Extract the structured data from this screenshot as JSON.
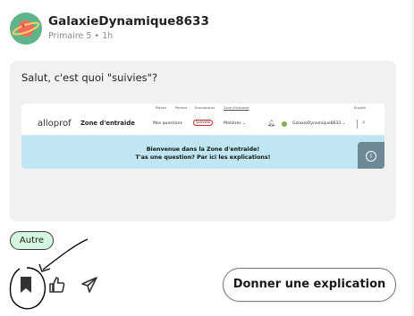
{
  "post": {
    "username": "GalaxieDynamique8633",
    "meta": "Primaire 5 • 1h",
    "avatar_icon": "planet-icon",
    "question": "Salut, c'est quoi \"suivies\"?",
    "tag": "Autre"
  },
  "screenshot": {
    "topnav": [
      "Élèves",
      "Parents",
      "Enseignants",
      "Zone d'entraide",
      "English"
    ],
    "logo": "alloprof",
    "zone_title": "Zone d'entraide",
    "links": [
      "Mes questions",
      "Suivies",
      "Matières ⌄"
    ],
    "user": "GalaxieDynamique8633 ⌄",
    "line1": "Bienvenue dans la Zone d'entraide!",
    "line2": "T'as une question? Par ici les explications!"
  },
  "actions": {
    "bookmark_icon": "bookmark-icon",
    "like_icon": "thumbs-up-icon",
    "share_icon": "share-icon",
    "answer_label": "Donner une explication"
  },
  "colors": {
    "avatar_bg": "#5fb48a",
    "tag_bg": "#d4f5df",
    "card_bg": "#f1f1f1",
    "screenshot_bg": "#bfe6f2"
  }
}
